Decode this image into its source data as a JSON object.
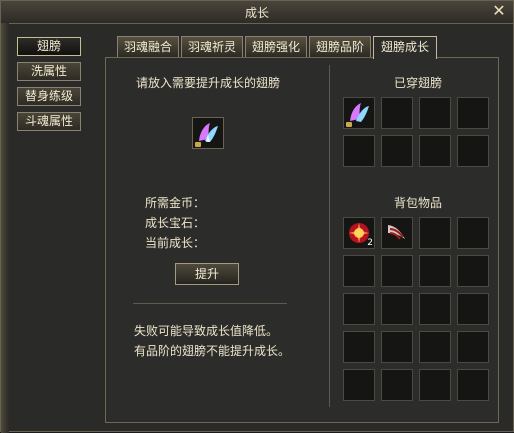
{
  "window": {
    "title": "成长"
  },
  "side_tabs": [
    {
      "label": "翅膀",
      "active": true
    },
    {
      "label": "洗属性",
      "active": false
    },
    {
      "label": "替身练级",
      "active": false
    },
    {
      "label": "斗魂属性",
      "active": false
    }
  ],
  "tabs": [
    {
      "label": "羽魂融合",
      "active": false
    },
    {
      "label": "羽魂祈灵",
      "active": false
    },
    {
      "label": "翅膀强化",
      "active": false
    },
    {
      "label": "翅膀品阶",
      "active": false
    },
    {
      "label": "翅膀成长",
      "active": true
    }
  ],
  "left": {
    "prompt": "请放入需要提升成长的翅膀",
    "gold_label": "所需金币：",
    "gem_label": "成长宝石：",
    "current_label": "当前成长：",
    "button": "提升",
    "note1": "失败可能导致成长值降低。",
    "note2": "有品阶的翅膀不能提升成长。"
  },
  "right": {
    "equipped_title": "已穿翅膀",
    "bag_title": "背包物品",
    "bag_item_count": "2"
  },
  "icons": {
    "close": "close-icon",
    "wing": "wing-icon",
    "orb": "fire-orb-icon",
    "feather": "feather-wing-icon"
  },
  "colors": {
    "accent": "#c8bb94",
    "text": "#ede5cc"
  }
}
